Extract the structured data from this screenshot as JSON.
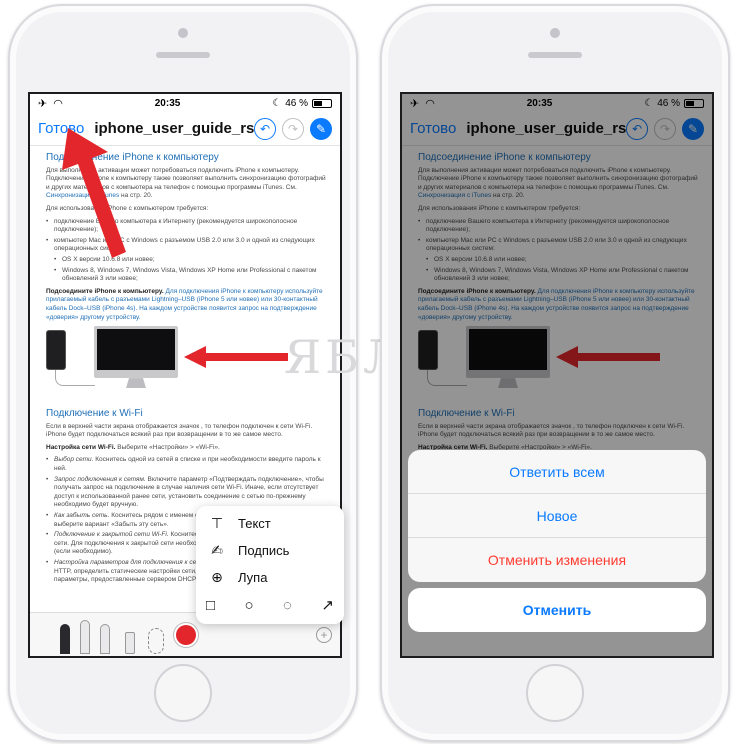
{
  "status": {
    "time": "20:35",
    "battery": "46 %"
  },
  "nav": {
    "done": "Готово",
    "title": "iphone_user_guide_rs...."
  },
  "doc": {
    "h1": "Подсоединение iPhone к компьютеру",
    "p1_a": "Для выполнения активации может потребоваться подключить iPhone к компьютеру. Подключение iPhone к компьютеру также позволяет выполнить синхронизацию фотографий и других материалов с компьютера на телефон с помощью программы iTunes. См.",
    "p1_link": "Синхронизация с iTunes",
    "p1_b": "на стр. 20.",
    "p2": "Для использования iPhone с компьютером требуется:",
    "req1": "подключение Вашего компьютера к Интернету (рекомендуется широкополосное подключение);",
    "req2": "компьютер Mac или PC с Windows с разъемом USB 2.0 или 3.0 и одной из следующих операционных систем:",
    "req2a": "OS X версии 10.6.8 или новее;",
    "req2b": "Windows 8, Windows 7, Windows Vista, Windows XP Home или Professional с пакетом обновлений 3 или новее;",
    "p3_bold": "Подсоедините iPhone к компьютеру.",
    "p3": "Для подключения iPhone к компьютеру используйте прилагаемый кабель с разъемами Lightning–USB (iPhone 5 или новее) или 30-контактный кабель Dock–USB (iPhone 4s). На каждом устройстве появится запрос на подтверждение «доверия» другому устройству.",
    "h2": "Подключение к Wi-Fi",
    "p4": "Если в верхней части экрана отображается значок , то телефон подключен к сети Wi-Fi. iPhone будет подключаться всякий раз при возвращении в то же самое место.",
    "p5_bold": "Настройка сети Wi-Fi.",
    "p5": "Выберите «Настройки» > «Wi-Fi».",
    "w1_i": "Выбор сети.",
    "w1": "Коснитесь одной из сетей в списке и при необходимости введите пароль к ней.",
    "w2_i": "Запрос подключения к сетям.",
    "w2": "Включите параметр «Подтверждать подключение», чтобы получать запрос на подключение в случае наличия сети Wi-Fi. Иначе, если отсутствует доступ к использованной ранее сети, установить соединение с сетью по-прежнему необходимо будет вручную.",
    "w3_i": "Как забыть сеть.",
    "w3": "Коснитесь рядом с именем сети, к которой Вы подключены ранее, и выберите вариант «Забыть эту сеть».",
    "w4_i": "Подключение к закрытой сети Wi-Fi.",
    "w4": "Коснитесь «Другая», затем введите имя закрытой сети. Для подключения к закрытой сети необходимо знать ее имя, тип защиты и пароль (если необходимо).",
    "w5_i": "Настройка параметров для подключения к сети Wi-Fi.",
    "w5": "Можно задать прокси-сервер HTTP, определить статические настройки сети, включить протокол BootP и обновить параметры, предоставленные сервером DHCP."
  },
  "popup": {
    "text": "Текст",
    "signature": "Подпись",
    "loupe": "Лупа"
  },
  "sheet": {
    "reply_all": "Ответить всем",
    "new": "Новое",
    "discard": "Отменить изменения",
    "cancel": "Отменить"
  },
  "watermark": "ЯБЛЫК",
  "colors": {
    "accent": "#0a7aff",
    "destructive": "#ff3b30",
    "arrow": "#e3262b"
  }
}
